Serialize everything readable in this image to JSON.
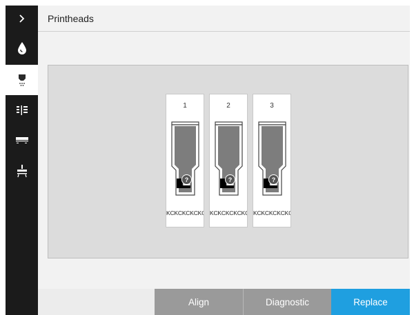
{
  "header": {
    "title": "Printheads"
  },
  "sidebar": {
    "items": [
      {
        "icon": "chevron-right-icon"
      },
      {
        "icon": "ink-drop-icon"
      },
      {
        "icon": "printhead-icon",
        "active": true
      },
      {
        "icon": "alignment-icon"
      },
      {
        "icon": "paper-icon"
      },
      {
        "icon": "maintenance-icon"
      }
    ]
  },
  "printheads": [
    {
      "number": "1",
      "colors": "KCKCKCKCKC",
      "status_icon": "question-icon"
    },
    {
      "number": "2",
      "colors": "KCKCKCKCKC",
      "status_icon": "question-icon"
    },
    {
      "number": "3",
      "colors": "KCKCKCKCKC",
      "status_icon": "question-icon"
    }
  ],
  "actions": {
    "align_label": "Align",
    "diagnostic_label": "Diagnostic",
    "replace_label": "Replace"
  },
  "colors": {
    "rail": "#1b1b1b",
    "accent": "#1f9fe0",
    "button_gray": "#9a9a9a"
  }
}
